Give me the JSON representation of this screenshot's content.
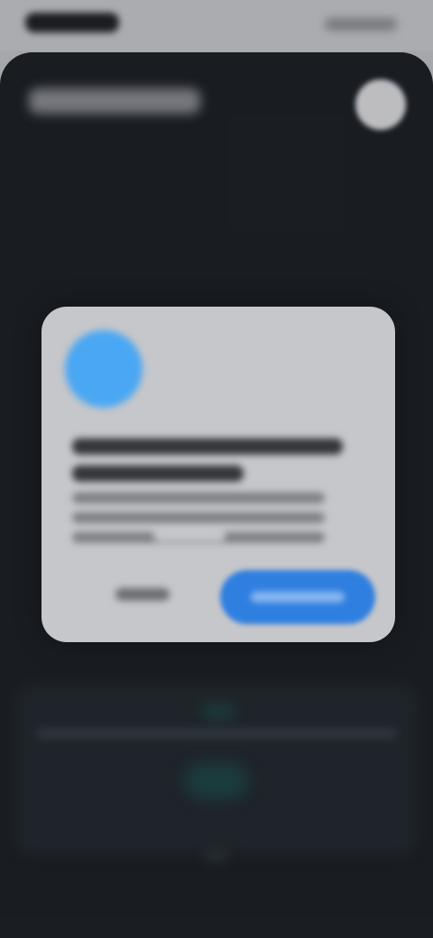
{
  "status_bar": {
    "time": "",
    "indicators": ""
  },
  "app": {
    "header_title": "",
    "header_button_icon": "close-icon"
  },
  "dialog": {
    "icon": "app-icon",
    "title": "",
    "body": "",
    "secondary_button_label": "",
    "primary_button_label": "",
    "primary_color": "#2f7fe0"
  }
}
